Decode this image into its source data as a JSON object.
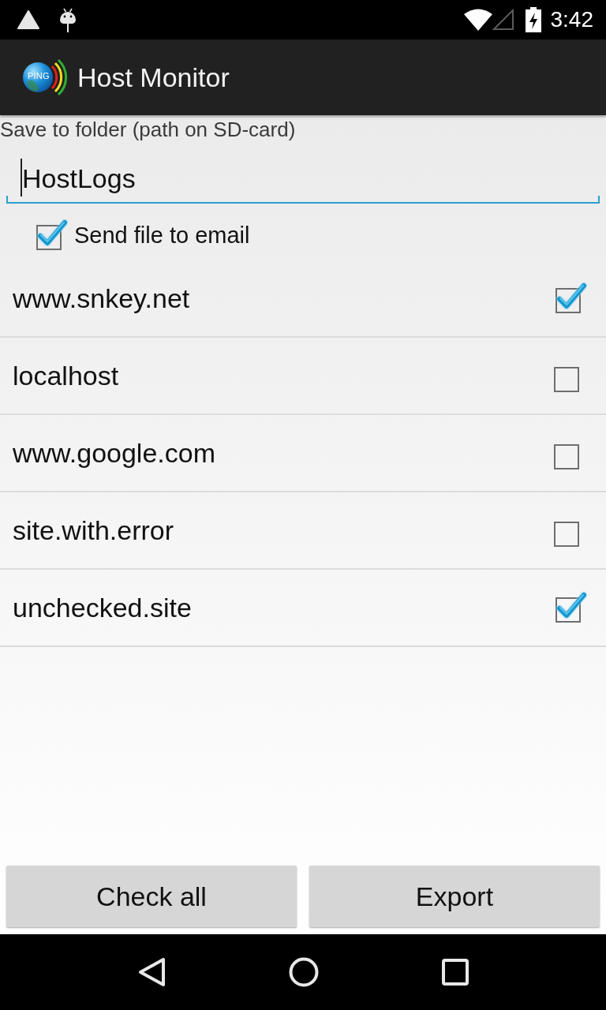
{
  "status_bar": {
    "time": "3:42"
  },
  "action_bar": {
    "logo_text": "PING",
    "title": "Host Monitor"
  },
  "folder_field": {
    "label": "Save to folder (path on SD-card)",
    "value": "HostLogs",
    "focused": true
  },
  "send_email": {
    "label": "Send file to email",
    "checked": true
  },
  "hosts": [
    {
      "name": "www.snkey.net",
      "checked": true
    },
    {
      "name": "localhost",
      "checked": false
    },
    {
      "name": "www.google.com",
      "checked": false
    },
    {
      "name": "site.with.error",
      "checked": false
    },
    {
      "name": "unchecked.site",
      "checked": true
    }
  ],
  "buttons": [
    {
      "label": "Check all"
    },
    {
      "label": "Export"
    }
  ]
}
